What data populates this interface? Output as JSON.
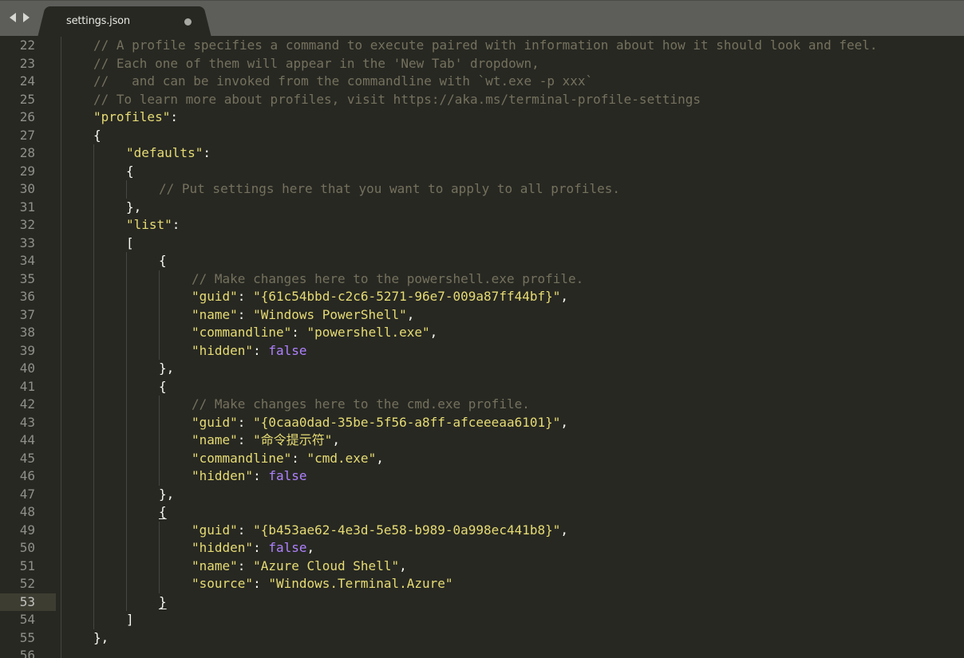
{
  "window": {
    "tab": {
      "label": "settings.json",
      "state_icon": "unsaved-dot-icon"
    },
    "nav": {
      "back_icon": "triangle-left-icon",
      "forward_icon": "triangle-right-icon"
    }
  },
  "editor": {
    "current_line": 53,
    "colors": {
      "background": "#272822",
      "comment": "#75715e",
      "string": "#e6db74",
      "keyword": "#ae81ff",
      "text": "#f8f8f2",
      "gutter": "#8f908a"
    },
    "lines": [
      {
        "n": "22",
        "indent": 1,
        "tokens": [
          {
            "t": "cm",
            "v": "// A profile specifies a command to execute paired with information about how it should look and feel."
          }
        ]
      },
      {
        "n": "23",
        "indent": 1,
        "tokens": [
          {
            "t": "cm",
            "v": "// Each one of them will appear in the 'New Tab' dropdown,"
          }
        ]
      },
      {
        "n": "24",
        "indent": 1,
        "tokens": [
          {
            "t": "cm",
            "v": "//   and can be invoked from the commandline with `wt.exe -p xxx`"
          }
        ]
      },
      {
        "n": "25",
        "indent": 1,
        "tokens": [
          {
            "t": "cm",
            "v": "// To learn more about profiles, visit https://aka.ms/terminal-profile-settings"
          }
        ]
      },
      {
        "n": "26",
        "indent": 1,
        "tokens": [
          {
            "t": "st",
            "v": "\"profiles\""
          },
          {
            "t": "pu",
            "v": ":"
          }
        ]
      },
      {
        "n": "27",
        "indent": 1,
        "tokens": [
          {
            "t": "pu",
            "v": "{"
          }
        ]
      },
      {
        "n": "28",
        "indent": 2,
        "tokens": [
          {
            "t": "st",
            "v": "\"defaults\""
          },
          {
            "t": "pu",
            "v": ":"
          }
        ]
      },
      {
        "n": "29",
        "indent": 2,
        "tokens": [
          {
            "t": "pu",
            "v": "{"
          }
        ]
      },
      {
        "n": "30",
        "indent": 3,
        "tokens": [
          {
            "t": "cm",
            "v": "// Put settings here that you want to apply to all profiles."
          }
        ]
      },
      {
        "n": "31",
        "indent": 2,
        "tokens": [
          {
            "t": "pu",
            "v": "},"
          }
        ]
      },
      {
        "n": "32",
        "indent": 2,
        "tokens": [
          {
            "t": "st",
            "v": "\"list\""
          },
          {
            "t": "pu",
            "v": ":"
          }
        ]
      },
      {
        "n": "33",
        "indent": 2,
        "tokens": [
          {
            "t": "pu",
            "v": "["
          }
        ]
      },
      {
        "n": "34",
        "indent": 3,
        "tokens": [
          {
            "t": "pu",
            "v": "{"
          }
        ]
      },
      {
        "n": "35",
        "indent": 4,
        "tokens": [
          {
            "t": "cm",
            "v": "// Make changes here to the powershell.exe profile."
          }
        ]
      },
      {
        "n": "36",
        "indent": 4,
        "tokens": [
          {
            "t": "st",
            "v": "\"guid\""
          },
          {
            "t": "pu",
            "v": ": "
          },
          {
            "t": "st",
            "v": "\"{61c54bbd-c2c6-5271-96e7-009a87ff44bf}\""
          },
          {
            "t": "pu",
            "v": ","
          }
        ]
      },
      {
        "n": "37",
        "indent": 4,
        "tokens": [
          {
            "t": "st",
            "v": "\"name\""
          },
          {
            "t": "pu",
            "v": ": "
          },
          {
            "t": "st",
            "v": "\"Windows PowerShell\""
          },
          {
            "t": "pu",
            "v": ","
          }
        ]
      },
      {
        "n": "38",
        "indent": 4,
        "tokens": [
          {
            "t": "st",
            "v": "\"commandline\""
          },
          {
            "t": "pu",
            "v": ": "
          },
          {
            "t": "st",
            "v": "\"powershell.exe\""
          },
          {
            "t": "pu",
            "v": ","
          }
        ]
      },
      {
        "n": "39",
        "indent": 4,
        "tokens": [
          {
            "t": "st",
            "v": "\"hidden\""
          },
          {
            "t": "pu",
            "v": ": "
          },
          {
            "t": "kw",
            "v": "false"
          }
        ]
      },
      {
        "n": "40",
        "indent": 3,
        "tokens": [
          {
            "t": "pu",
            "v": "},"
          }
        ]
      },
      {
        "n": "41",
        "indent": 3,
        "tokens": [
          {
            "t": "pu",
            "v": "{"
          }
        ]
      },
      {
        "n": "42",
        "indent": 4,
        "tokens": [
          {
            "t": "cm",
            "v": "// Make changes here to the cmd.exe profile."
          }
        ]
      },
      {
        "n": "43",
        "indent": 4,
        "tokens": [
          {
            "t": "st",
            "v": "\"guid\""
          },
          {
            "t": "pu",
            "v": ": "
          },
          {
            "t": "st",
            "v": "\"{0caa0dad-35be-5f56-a8ff-afceeeaa6101}\""
          },
          {
            "t": "pu",
            "v": ","
          }
        ]
      },
      {
        "n": "44",
        "indent": 4,
        "tokens": [
          {
            "t": "st",
            "v": "\"name\""
          },
          {
            "t": "pu",
            "v": ": "
          },
          {
            "t": "st",
            "v": "\"命令提示符\""
          },
          {
            "t": "pu",
            "v": ","
          }
        ]
      },
      {
        "n": "45",
        "indent": 4,
        "tokens": [
          {
            "t": "st",
            "v": "\"commandline\""
          },
          {
            "t": "pu",
            "v": ": "
          },
          {
            "t": "st",
            "v": "\"cmd.exe\""
          },
          {
            "t": "pu",
            "v": ","
          }
        ]
      },
      {
        "n": "46",
        "indent": 4,
        "tokens": [
          {
            "t": "st",
            "v": "\"hidden\""
          },
          {
            "t": "pu",
            "v": ": "
          },
          {
            "t": "kw",
            "v": "false"
          }
        ]
      },
      {
        "n": "47",
        "indent": 3,
        "tokens": [
          {
            "t": "pu",
            "v": "},"
          }
        ]
      },
      {
        "n": "48",
        "indent": 3,
        "tokens": [
          {
            "t": "pu ul",
            "v": "{"
          }
        ]
      },
      {
        "n": "49",
        "indent": 4,
        "tokens": [
          {
            "t": "st",
            "v": "\"guid\""
          },
          {
            "t": "pu",
            "v": ": "
          },
          {
            "t": "st",
            "v": "\"{b453ae62-4e3d-5e58-b989-0a998ec441b8}\""
          },
          {
            "t": "pu",
            "v": ","
          }
        ]
      },
      {
        "n": "50",
        "indent": 4,
        "tokens": [
          {
            "t": "st",
            "v": "\"hidden\""
          },
          {
            "t": "pu",
            "v": ": "
          },
          {
            "t": "kw",
            "v": "false"
          },
          {
            "t": "pu",
            "v": ","
          }
        ]
      },
      {
        "n": "51",
        "indent": 4,
        "tokens": [
          {
            "t": "st",
            "v": "\"name\""
          },
          {
            "t": "pu",
            "v": ": "
          },
          {
            "t": "st",
            "v": "\"Azure Cloud Shell\""
          },
          {
            "t": "pu",
            "v": ","
          }
        ]
      },
      {
        "n": "52",
        "indent": 4,
        "tokens": [
          {
            "t": "st",
            "v": "\"source\""
          },
          {
            "t": "pu",
            "v": ": "
          },
          {
            "t": "st",
            "v": "\"Windows.Terminal.Azure\""
          }
        ]
      },
      {
        "n": "53",
        "indent": 3,
        "tokens": [
          {
            "t": "pu ul",
            "v": "}"
          }
        ]
      },
      {
        "n": "54",
        "indent": 2,
        "tokens": [
          {
            "t": "pu",
            "v": "]"
          }
        ]
      },
      {
        "n": "55",
        "indent": 1,
        "tokens": [
          {
            "t": "pu",
            "v": "},"
          }
        ]
      },
      {
        "n": "56",
        "indent": 0,
        "tokens": []
      }
    ]
  }
}
